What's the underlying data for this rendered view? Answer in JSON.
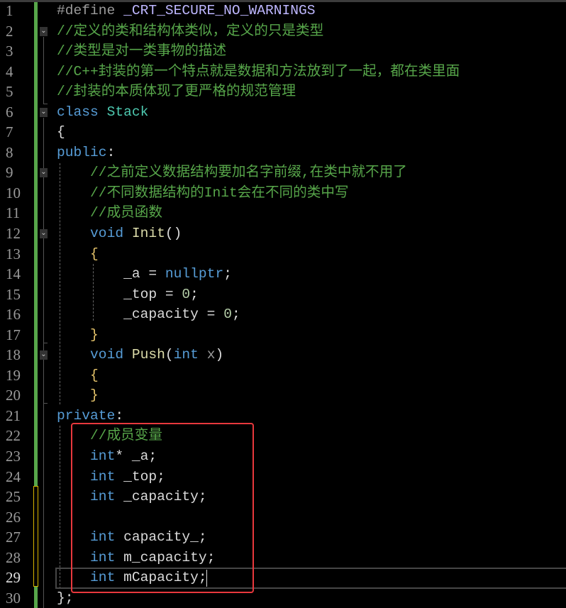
{
  "editor": {
    "current_line": 29,
    "lines": [
      [
        [
          "#define ",
          "pp"
        ],
        [
          "_CRT_SECURE_NO_WARNINGS",
          "mac"
        ]
      ],
      [
        [
          "//定义的类和结构体类似，定义的只是类型",
          "cm"
        ]
      ],
      [
        [
          "//类型是对一类事物的描述",
          "cm"
        ]
      ],
      [
        [
          "//C++封装的第一个特点就是数据和方法放到了一起，都在类里面",
          "cm"
        ]
      ],
      [
        [
          "//封装的本质体现了更严格的规范管理",
          "cm"
        ]
      ],
      [
        [
          "class ",
          "kw"
        ],
        [
          "Stack",
          "ty"
        ]
      ],
      [
        [
          "{",
          "pl"
        ]
      ],
      [
        [
          "public",
          "kw"
        ],
        [
          ":",
          "pl"
        ]
      ],
      [
        [
          "    ",
          "pl"
        ],
        [
          "//之前定义数据结构要加名字前缀,在类中就不用了",
          "cm"
        ]
      ],
      [
        [
          "    ",
          "pl"
        ],
        [
          "//不同数据结构的Init会在不同的类中写",
          "cm"
        ]
      ],
      [
        [
          "    ",
          "pl"
        ],
        [
          "//成员函数",
          "cm"
        ]
      ],
      [
        [
          "    ",
          "pl"
        ],
        [
          "void ",
          "kw"
        ],
        [
          "Init",
          "fn"
        ],
        [
          "()",
          "pl"
        ]
      ],
      [
        [
          "    ",
          "pl"
        ],
        [
          "{",
          "br"
        ]
      ],
      [
        [
          "        ",
          "pl"
        ],
        [
          "_a",
          "mem"
        ],
        [
          " = ",
          "pl"
        ],
        [
          "nullptr",
          "kw"
        ],
        [
          ";",
          "pl"
        ]
      ],
      [
        [
          "        ",
          "pl"
        ],
        [
          "_top",
          "mem"
        ],
        [
          " = ",
          "pl"
        ],
        [
          "0",
          "num"
        ],
        [
          ";",
          "pl"
        ]
      ],
      [
        [
          "        ",
          "pl"
        ],
        [
          "_capacity",
          "mem"
        ],
        [
          " = ",
          "pl"
        ],
        [
          "0",
          "num"
        ],
        [
          ";",
          "pl"
        ]
      ],
      [
        [
          "    ",
          "pl"
        ],
        [
          "}",
          "br"
        ]
      ],
      [
        [
          "    ",
          "pl"
        ],
        [
          "void ",
          "kw"
        ],
        [
          "Push",
          "fn"
        ],
        [
          "(",
          "pl"
        ],
        [
          "int ",
          "kw"
        ],
        [
          "x",
          "par"
        ],
        [
          ")",
          "pl"
        ]
      ],
      [
        [
          "    ",
          "pl"
        ],
        [
          "{",
          "br"
        ]
      ],
      [
        [
          "    ",
          "pl"
        ],
        [
          "}",
          "br"
        ]
      ],
      [
        [
          "private",
          "kw"
        ],
        [
          ":",
          "pl"
        ]
      ],
      [
        [
          "    ",
          "pl"
        ],
        [
          "//成员变量",
          "cm"
        ]
      ],
      [
        [
          "    ",
          "pl"
        ],
        [
          "int",
          "kw"
        ],
        [
          "* ",
          "pl"
        ],
        [
          "_a",
          "mem"
        ],
        [
          ";",
          "pl"
        ]
      ],
      [
        [
          "    ",
          "pl"
        ],
        [
          "int ",
          "kw"
        ],
        [
          "_top",
          "mem"
        ],
        [
          ";",
          "pl"
        ]
      ],
      [
        [
          "    ",
          "pl"
        ],
        [
          "int ",
          "kw"
        ],
        [
          "_capacity",
          "mem"
        ],
        [
          ";",
          "pl"
        ]
      ],
      [
        [
          "",
          "pl"
        ]
      ],
      [
        [
          "    ",
          "pl"
        ],
        [
          "int ",
          "kw"
        ],
        [
          "capacity_",
          "mem"
        ],
        [
          ";",
          "pl"
        ]
      ],
      [
        [
          "    ",
          "pl"
        ],
        [
          "int ",
          "kw"
        ],
        [
          "m_capacity",
          "mem"
        ],
        [
          ";",
          "pl"
        ]
      ],
      [
        [
          "    ",
          "pl"
        ],
        [
          "int ",
          "kw"
        ],
        [
          "mCapacity",
          "mem"
        ],
        [
          ";",
          "pl"
        ]
      ],
      [
        [
          "}",
          "pl"
        ],
        [
          ";",
          "pl"
        ]
      ]
    ]
  }
}
